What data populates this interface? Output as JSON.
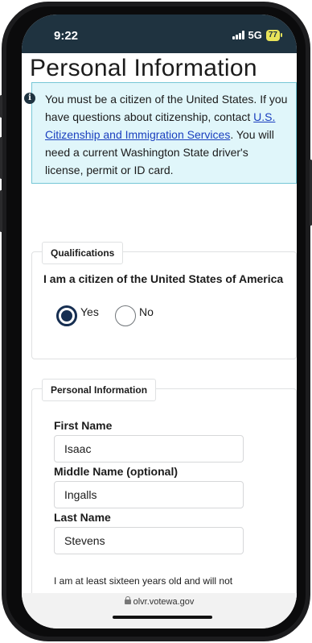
{
  "status_bar": {
    "time": "9:22",
    "network": "5G",
    "battery": "77"
  },
  "page": {
    "title": "Personal Information",
    "alert": {
      "text_before": "You must be a citizen of the United States. If you have questions about citizenship, contact ",
      "link": "U.S. Citizenship and Immigration Services",
      "text_after": ". You will need a current Washington State driver's license, permit or ID card."
    }
  },
  "qualifications": {
    "legend": "Qualifications",
    "question": "I am a citizen of the United States of America",
    "options": [
      {
        "label": "Yes",
        "checked": true
      },
      {
        "label": "No",
        "checked": false
      }
    ]
  },
  "personal_info": {
    "legend": "Personal Information",
    "first_name": {
      "label": "First Name",
      "value": "Isaac"
    },
    "middle_name": {
      "label": "Middle Name (optional)",
      "value": "Ingalls"
    },
    "last_name": {
      "label": "Last Name",
      "value": "Stevens"
    },
    "age_text": "I am at least sixteen years old and will not vote in a special or general"
  },
  "browser": {
    "url": "olvr.votewa.gov"
  }
}
